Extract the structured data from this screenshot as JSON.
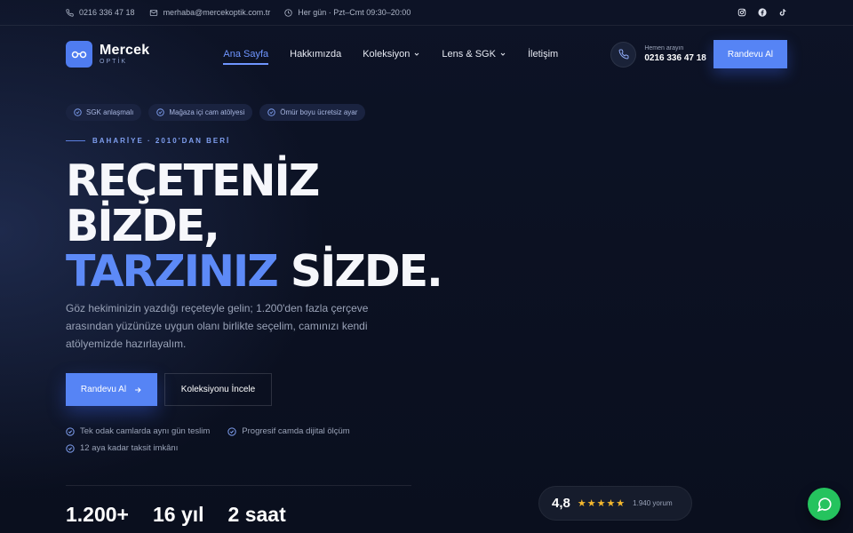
{
  "topbar": {
    "phone": "0216 336 47 18",
    "email": "merhaba@mercekoptik.com.tr",
    "hours": "Her gün · Pzt–Cmt 09:30–20:00",
    "social_icons": [
      "instagram-icon",
      "facebook-icon",
      "tiktok-icon"
    ]
  },
  "brand": {
    "name": "Mercek",
    "sub": "OPTİK",
    "accent": "#5684f5"
  },
  "nav": {
    "items": [
      {
        "label": "Ana Sayfa",
        "active": true
      },
      {
        "label": "Hakkımızda"
      },
      {
        "label": "Koleksiyon",
        "dropdown": true
      },
      {
        "label": "Lens & SGK",
        "dropdown": true
      },
      {
        "label": "İletişim"
      }
    ]
  },
  "header": {
    "call_label": "Hemen arayın",
    "call_number": "0216 336 47 18",
    "cta_label": "Randevu Al"
  },
  "hero": {
    "badges": [
      "SGK anlaşmalı",
      "Mağaza içi cam atölyesi",
      "Ömür boyu ücretsiz ayar"
    ],
    "eyebrow": "BAHARİYE · 2010'DAN BERİ",
    "headline_line1": "REÇETENİZ",
    "headline_line2": "BİZDE,",
    "headline_line3_accent": "TARZINIZ",
    "headline_line3_rest": " SİZDE.",
    "lead": "Göz hekiminizin yazdığı reçeteyle gelin; 1.200'den fazla çerçeve arasından yüzünüze uygun olanı birlikte seçelim, camınızı kendi atölyemizde hazırlayalım.",
    "cta_primary": "Randevu Al",
    "cta_secondary": "Koleksiyonu İncele",
    "features": [
      "Tek odak camlarda aynı gün teslim",
      "Progresif camda dijital ölçüm",
      "12 aya kadar taksit imkânı"
    ],
    "stats": [
      "1.200+",
      "16 yıl",
      "2 saat"
    ]
  },
  "rating": {
    "score": "4,8",
    "stars": 5,
    "count": "1.940 yorum"
  },
  "whatsapp": {
    "icon": "chat-bubble-icon",
    "color": "#25c35e"
  }
}
